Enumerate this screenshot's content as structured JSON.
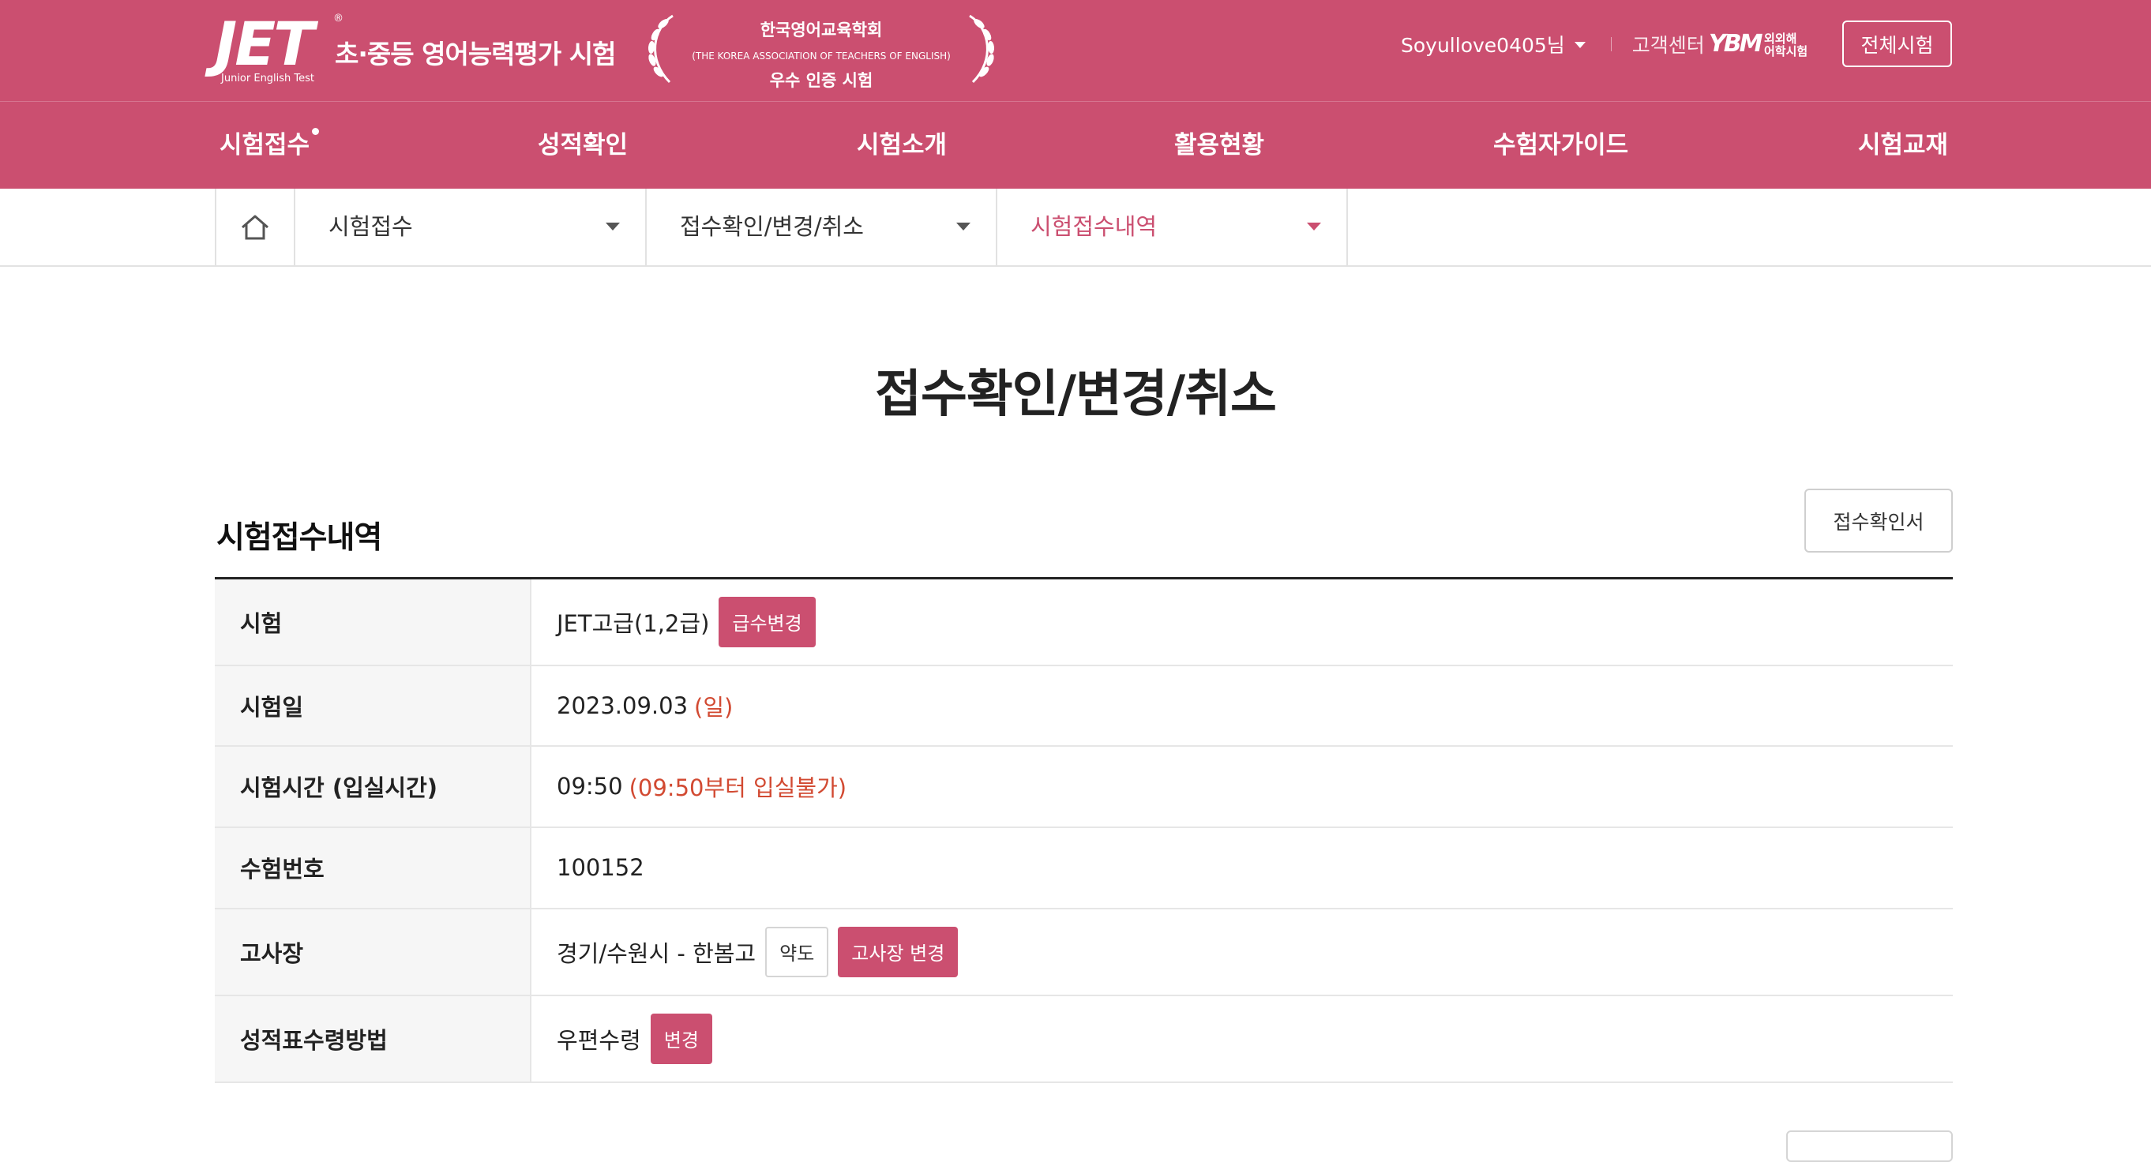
{
  "header": {
    "logo_text": "JET",
    "logo_reg": "®",
    "logo_subtitle": "Junior English Test",
    "logo_tagline": "초·중등 영어능력평가 시험",
    "emblem_line1": "한국영어교육학회",
    "emblem_line2": "(THE KOREA ASSOCIATION OF TEACHERS OF ENGLISH)",
    "emblem_line3": "우수 인증 시험",
    "user_name": "Soyullove0405님",
    "customer_center": "고객센터",
    "ybm_mark": "YBM",
    "ybm_text_line1": "외외해",
    "ybm_text_line2": "어학시험",
    "all_exams_button": "전체시험"
  },
  "gnb": {
    "items": [
      "시험접수",
      "성적확인",
      "시험소개",
      "활용현황",
      "수험자가이드",
      "시험교재"
    ],
    "active_index": 0
  },
  "breadcrumb": {
    "items": [
      "시험접수",
      "접수확인/변경/취소",
      "시험접수내역"
    ],
    "active_index": 2
  },
  "page": {
    "title": "접수확인/변경/취소",
    "section_title": "시험접수내역",
    "confirm_button": "접수확인서"
  },
  "rows": {
    "exam": {
      "label": "시험",
      "value": "JET고급(1,2급)",
      "button": "급수변경"
    },
    "date": {
      "label": "시험일",
      "value": "2023.09.03",
      "day": "(일)"
    },
    "time": {
      "label": "시험시간 (입실시간)",
      "value": "09:50",
      "note": "(09:50부터 입실불가)"
    },
    "number": {
      "label": "수험번호",
      "value": "100152"
    },
    "site": {
      "label": "고사장",
      "value": "경기/수원시 - 한봄고",
      "map_button": "약도",
      "change_button": "고사장 변경"
    },
    "report": {
      "label": "성적표수령방법",
      "value": "우편수령",
      "button": "변경"
    }
  },
  "colors": {
    "brand": "#cb4f70",
    "accent_red": "#d24a32"
  }
}
